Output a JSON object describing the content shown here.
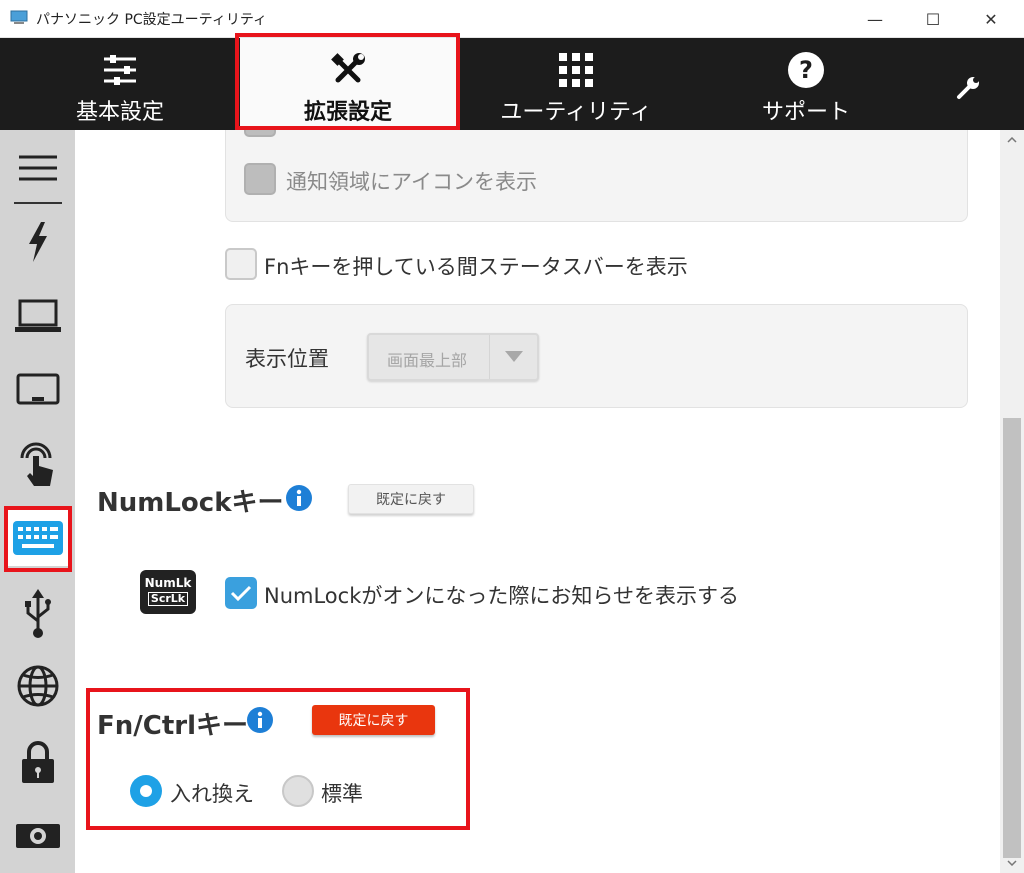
{
  "window": {
    "title": "パナソニック PC設定ユーティリティ",
    "minimize_glyph": "—",
    "maximize_glyph": "☐",
    "close_glyph": "✕"
  },
  "tabs": [
    {
      "label": "基本設定",
      "icon": "sliders-icon"
    },
    {
      "label": "拡張設定",
      "icon": "tools-icon",
      "selected": true
    },
    {
      "label": "ユーティリティ",
      "icon": "grid-icon"
    },
    {
      "label": "サポート",
      "icon": "help-icon"
    }
  ],
  "sidebar": {
    "items": [
      "menu-icon",
      "power-icon",
      "laptop-icon",
      "display-icon",
      "touch-icon",
      "keyboard-icon",
      "usb-icon",
      "globe-icon",
      "lock-icon",
      "camera-icon"
    ],
    "selected": "keyboard-icon"
  },
  "settings": {
    "notify_icon_label": "通知領域にアイコンを表示",
    "fn_status_label": "Fnキーを押している間ステータスバーを表示",
    "position_label": "表示位置",
    "position_value": "画面最上部"
  },
  "numlock": {
    "title": "NumLockキー",
    "reset_label": "既定に戻す",
    "key_top": "NumLk",
    "key_bottom": "ScrLk",
    "checkbox_label": "NumLockがオンになった際にお知らせを表示する",
    "checked": true
  },
  "fnctrl": {
    "title": "Fn/Ctrlキー",
    "reset_label": "既定に戻す",
    "options": [
      "入れ換え",
      "標準"
    ],
    "selected": "入れ換え"
  },
  "colors": {
    "nav_bg": "#1c1c1c",
    "highlight": "#e8141b",
    "accent_blue": "#1ea1e6",
    "reset_red": "#e9360e",
    "sidebar_bg": "#d3d3d3"
  }
}
